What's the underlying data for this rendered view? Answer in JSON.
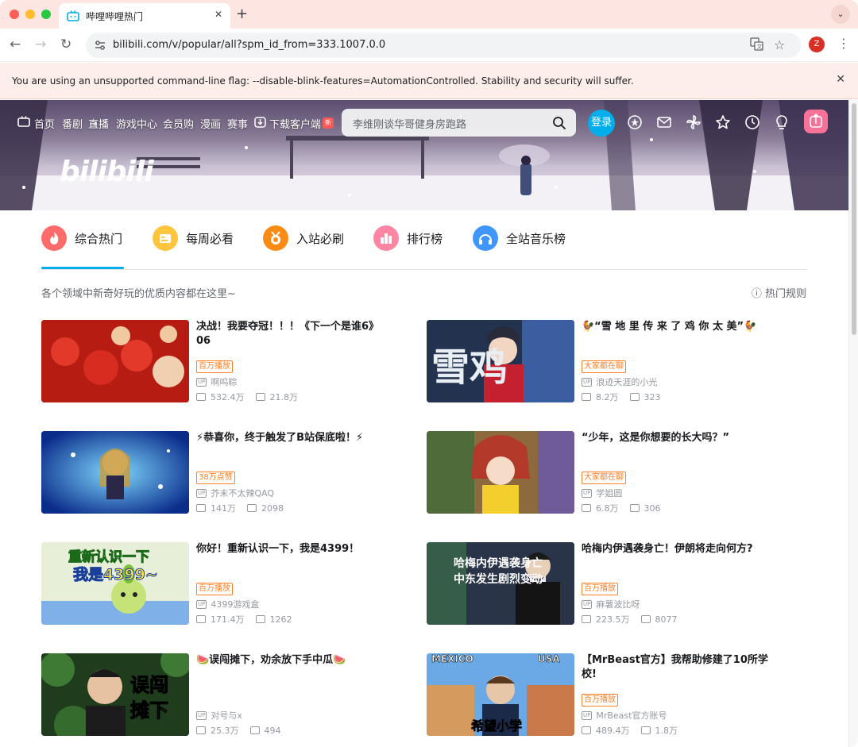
{
  "browser": {
    "tab_title": "哔哩哔哩热门",
    "tab_close": "✕",
    "new_tab": "+",
    "url": "bilibili.com/v/popular/all?spm_id_from=333.1007.0.0",
    "profile_initial": "Z",
    "infobar_text": "You are using an unsupported command-line flag: --disable-blink-features=AutomationControlled. Stability and security will suffer.",
    "infobar_close": "✕"
  },
  "header": {
    "nav": [
      "首页",
      "番剧",
      "直播",
      "游戏中心",
      "会员购",
      "漫画",
      "赛事",
      "下载客户端"
    ],
    "new_badge": "新",
    "search_placeholder": "李维刚谈华哥健身房跑路",
    "login_label": "登录",
    "logo_text": "bilibili"
  },
  "categories": [
    {
      "label": "综合热门",
      "color": "#ff6b6b",
      "icon": "fire-icon"
    },
    {
      "label": "每周必看",
      "color": "#ffc53d",
      "icon": "calendar-icon"
    },
    {
      "label": "入站必刷",
      "color": "#fa8c16",
      "icon": "medal-icon"
    },
    {
      "label": "排行榜",
      "color": "#ff85a2",
      "icon": "ranking-icon"
    },
    {
      "label": "全站音乐榜",
      "color": "#4096ff",
      "icon": "headphones-icon"
    }
  ],
  "subtitle": "各个领域中新奇好玩的优质内容都在这里~",
  "rules_label": "热门规则",
  "videos": [
    {
      "title": "决战！我要夺冠！！！《下一个是谁6》06",
      "badge": "百万播放",
      "uploader": "啊呜粽",
      "views": "532.4万",
      "danmaku": "21.8万",
      "thumb_bg": "#c8211b"
    },
    {
      "title": "🐓“雪 地 里 传 来 了 鸡 你 太 美”🐓",
      "badge": "大家都在聊",
      "uploader": "浪迹天涯的小光",
      "views": "8.2万",
      "danmaku": "323",
      "thumb_bg": "#1f2c45",
      "thumb_text": "雪鸡"
    },
    {
      "title": "⚡恭喜你，终于触发了B站保底啦！⚡",
      "badge": "38万点赞",
      "uploader": "芥末不太辣QAQ",
      "views": "141万",
      "danmaku": "2098",
      "thumb_bg": "#0b2d8a"
    },
    {
      "title": "“少年，这是你想要的长大吗？”",
      "badge": "大家都在聊",
      "uploader": "学姐圆",
      "views": "6.8万",
      "danmaku": "306",
      "thumb_bg": "#b76a2a"
    },
    {
      "title": "你好！重新认识一下，我是4399！",
      "badge": "百万播放",
      "uploader": "4399游戏盒",
      "views": "171.4万",
      "danmaku": "1262",
      "thumb_bg": "#c9df8a",
      "thumb_text_a": "重新认识一下",
      "thumb_text_b": "我是4399~"
    },
    {
      "title": "哈梅内伊遇袭身亡！伊朗将走向何方?",
      "badge": "百万播放",
      "uploader": "麻薯波比呀",
      "views": "223.5万",
      "danmaku": "8077",
      "thumb_bg": "#1c2a3e",
      "thumb_text_a": "哈梅内伊遇袭身亡",
      "thumb_text_b": "中东发生剧烈变动"
    },
    {
      "title": "🍉误闯摊下，劝余放下手中瓜🍉",
      "badge": "",
      "uploader": "对号与x",
      "views": "25.3万",
      "danmaku": "494",
      "thumb_bg": "#2d5a27",
      "thumb_text_a": "误闯",
      "thumb_text_b": "摊下"
    },
    {
      "title": "【MrBeast官方】我帮助修建了10所学校!",
      "badge": "百万播放",
      "uploader": "MrBeast官方账号",
      "views": "489.4万",
      "danmaku": "1.8万",
      "thumb_bg": "#4a8fd6",
      "thumb_text_a": "MEXICO",
      "thumb_text_b": "USA",
      "thumb_text_c": "希望小学"
    }
  ]
}
